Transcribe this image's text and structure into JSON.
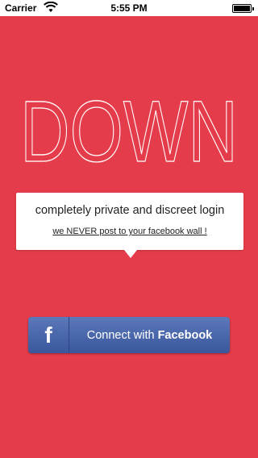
{
  "status_bar": {
    "carrier": "Carrier",
    "time": "5:55 PM"
  },
  "logo": {
    "text": "DOWN"
  },
  "tooltip": {
    "title": "completely private and discreet login",
    "subtitle": "we NEVER post to your facebook wall !"
  },
  "facebook_button": {
    "icon": "facebook-f-icon",
    "prefix": "Connect with",
    "brand": "Facebook"
  },
  "colors": {
    "background": "#e43c4a",
    "facebook_blue": "#3b579d",
    "white": "#ffffff"
  }
}
